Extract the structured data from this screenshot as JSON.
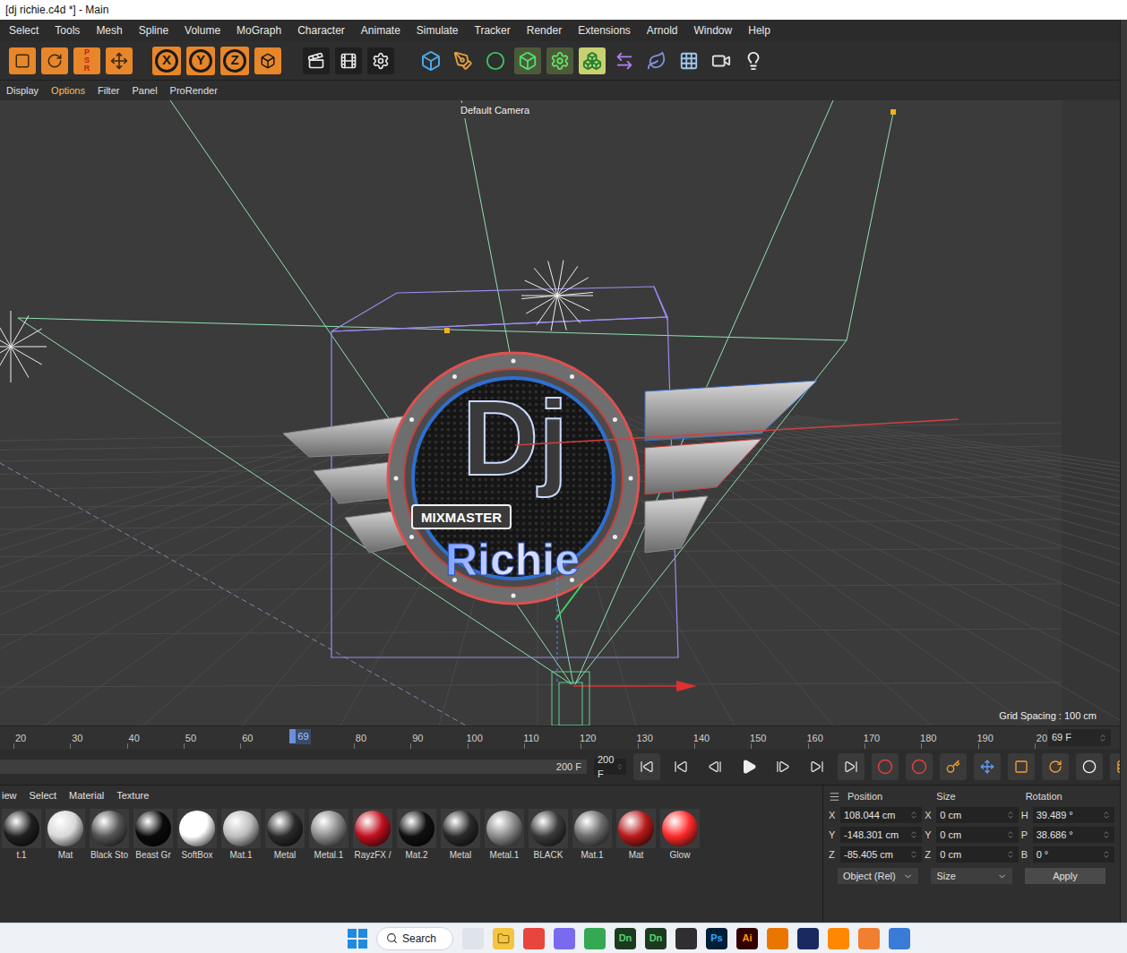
{
  "window": {
    "title": "[dj richie.c4d *] - Main"
  },
  "menubar": [
    "Select",
    "Tools",
    "Mesh",
    "Spline",
    "Volume",
    "MoGraph",
    "Character",
    "Animate",
    "Simulate",
    "Tracker",
    "Render",
    "Extensions",
    "Arnold",
    "Window",
    "Help"
  ],
  "toolbar": {
    "psr": [
      "P",
      "S",
      "R"
    ],
    "axis_locks": [
      "X",
      "Y",
      "Z"
    ]
  },
  "viewport": {
    "menu": [
      {
        "label": "Display",
        "selected": false
      },
      {
        "label": "Options",
        "selected": true
      },
      {
        "label": "Filter",
        "selected": false
      },
      {
        "label": "Panel",
        "selected": false
      },
      {
        "label": "ProRender",
        "selected": false
      }
    ],
    "camera": "Default Camera",
    "grid_spacing": "Grid Spacing : 100 cm",
    "logo": {
      "title": "Dj",
      "banner": "MIXMASTER",
      "name": "Richie"
    }
  },
  "timeline": {
    "ticks": [
      "20",
      "30",
      "40",
      "50",
      "60",
      "80",
      "90",
      "100",
      "110",
      "120",
      "130",
      "140",
      "150",
      "160",
      "170",
      "180",
      "190",
      "20"
    ],
    "current": "69",
    "current_field": "69 F",
    "range_label": "200 F",
    "end_field": "200 F"
  },
  "materials": {
    "menu": [
      "iew",
      "Select",
      "Material",
      "Texture"
    ],
    "items": [
      {
        "name": "t.1",
        "color": "#202020"
      },
      {
        "name": "Mat",
        "color": "#d8d8d8"
      },
      {
        "name": "Black Sto",
        "color": "#555555"
      },
      {
        "name": "Beast Gr",
        "color": "#0a0a0a"
      },
      {
        "name": "SoftBox",
        "color": "#ffffff"
      },
      {
        "name": "Mat.1",
        "color": "#bdbdbd"
      },
      {
        "name": "Metal",
        "color": "#2a2a2a"
      },
      {
        "name": "Metal.1",
        "color": "#8a8a8a"
      },
      {
        "name": "RayzFX /",
        "color": "#c0101e"
      },
      {
        "name": "Mat.2",
        "color": "#101010"
      },
      {
        "name": "Metal",
        "color": "#2a2a2a"
      },
      {
        "name": "Metal.1",
        "color": "#8a8a8a"
      },
      {
        "name": "BLACK",
        "color": "#3a3a3a"
      },
      {
        "name": "Mat.1",
        "color": "#6a6a6a"
      },
      {
        "name": "Mat",
        "color": "#b81a1a"
      },
      {
        "name": "Glow",
        "color": "#ff2a2a"
      }
    ]
  },
  "coordinates": {
    "headers": [
      "Position",
      "Size",
      "Rotation"
    ],
    "rows": [
      {
        "axis": "X",
        "position": "108.044 cm",
        "size_axis": "X",
        "size": "0 cm",
        "rot_axis": "H",
        "rotation": "39.489 °"
      },
      {
        "axis": "Y",
        "position": "-148.301 cm",
        "size_axis": "Y",
        "size": "0 cm",
        "rot_axis": "P",
        "rotation": "38.686 °"
      },
      {
        "axis": "Z",
        "position": "-85.405 cm",
        "size_axis": "Z",
        "size": "0 cm",
        "rot_axis": "B",
        "rotation": "0 °"
      }
    ],
    "mode": "Object (Rel)",
    "size_mode": "Size",
    "apply": "Apply"
  },
  "taskbar": {
    "search": "Search",
    "app_labels": [
      "Dn",
      "Dn",
      "Ps",
      "Ai"
    ]
  }
}
